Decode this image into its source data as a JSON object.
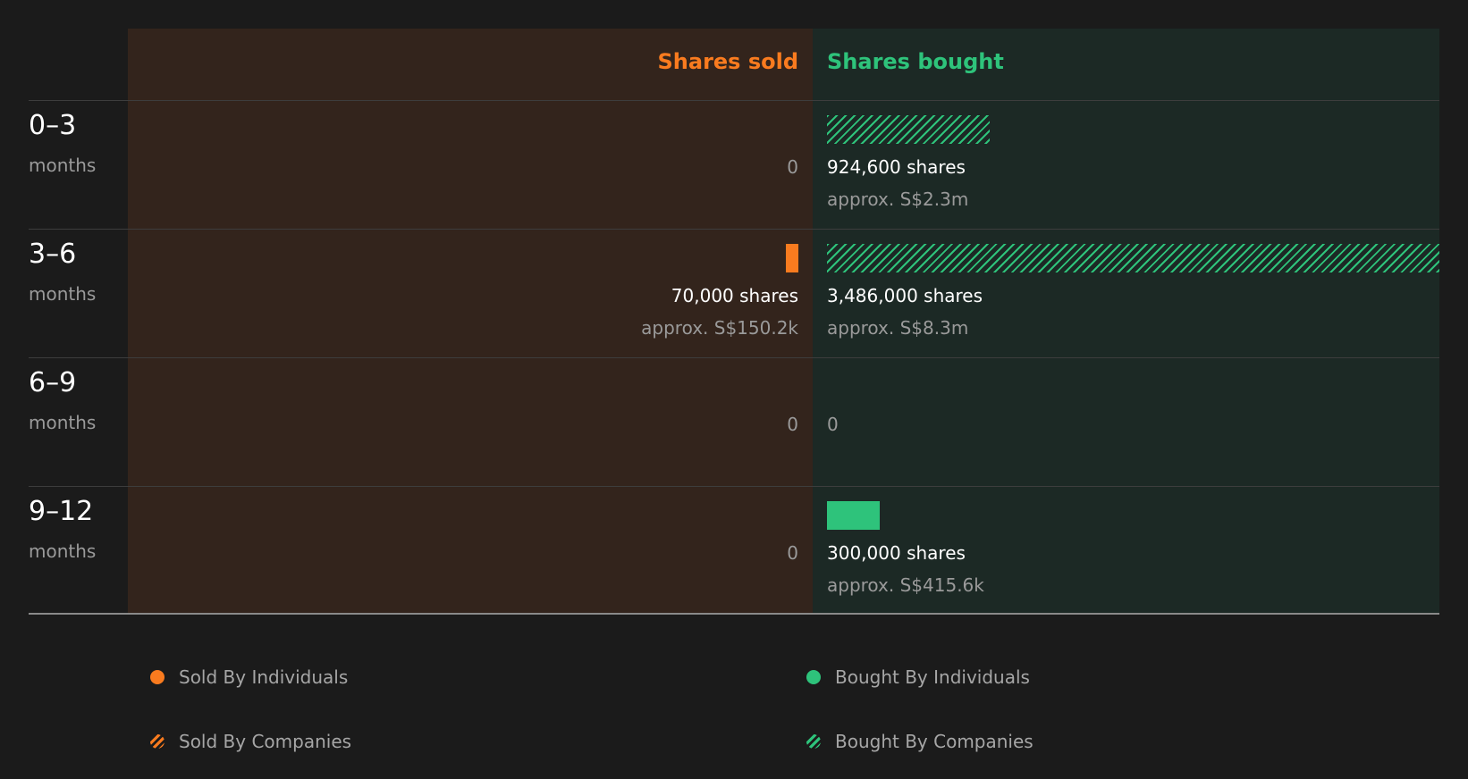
{
  "chart_data": {
    "type": "bar",
    "headers": {
      "sold": "Shares sold",
      "bought": "Shares bought"
    },
    "colors": {
      "sold": "#f97b1f",
      "bought": "#2ec37b",
      "sold_bg": "#33241c",
      "bought_bg": "#1c2925"
    },
    "rows": [
      {
        "range": "0–3",
        "unit": "months",
        "sold": {
          "shares": 0,
          "label": "0",
          "approx": ""
        },
        "bought": {
          "shares": 924600,
          "label": "924,600 shares",
          "approx": "approx. S$2.3m",
          "by": "companies"
        }
      },
      {
        "range": "3–6",
        "unit": "months",
        "sold": {
          "shares": 70000,
          "label": "70,000 shares",
          "approx": "approx. S$150.2k",
          "by": "individuals"
        },
        "bought": {
          "shares": 3486000,
          "label": "3,486,000 shares",
          "approx": "approx. S$8.3m",
          "by": "companies"
        }
      },
      {
        "range": "6–9",
        "unit": "months",
        "sold": {
          "shares": 0,
          "label": "0",
          "approx": ""
        },
        "bought": {
          "shares": 0,
          "label": "0",
          "approx": ""
        }
      },
      {
        "range": "9–12",
        "unit": "months",
        "sold": {
          "shares": 0,
          "label": "0",
          "approx": ""
        },
        "bought": {
          "shares": 300000,
          "label": "300,000 shares",
          "approx": "approx. S$415.6k",
          "by": "individuals"
        }
      }
    ],
    "legend": [
      {
        "label": "Sold By Individuals",
        "style": "solid",
        "color": "#f97b1f"
      },
      {
        "label": "Bought By Individuals",
        "style": "solid",
        "color": "#2ec37b"
      },
      {
        "label": "Sold By Companies",
        "style": "hatched",
        "color": "#f97b1f"
      },
      {
        "label": "Bought By Companies",
        "style": "hatched",
        "color": "#2ec37b"
      }
    ]
  }
}
